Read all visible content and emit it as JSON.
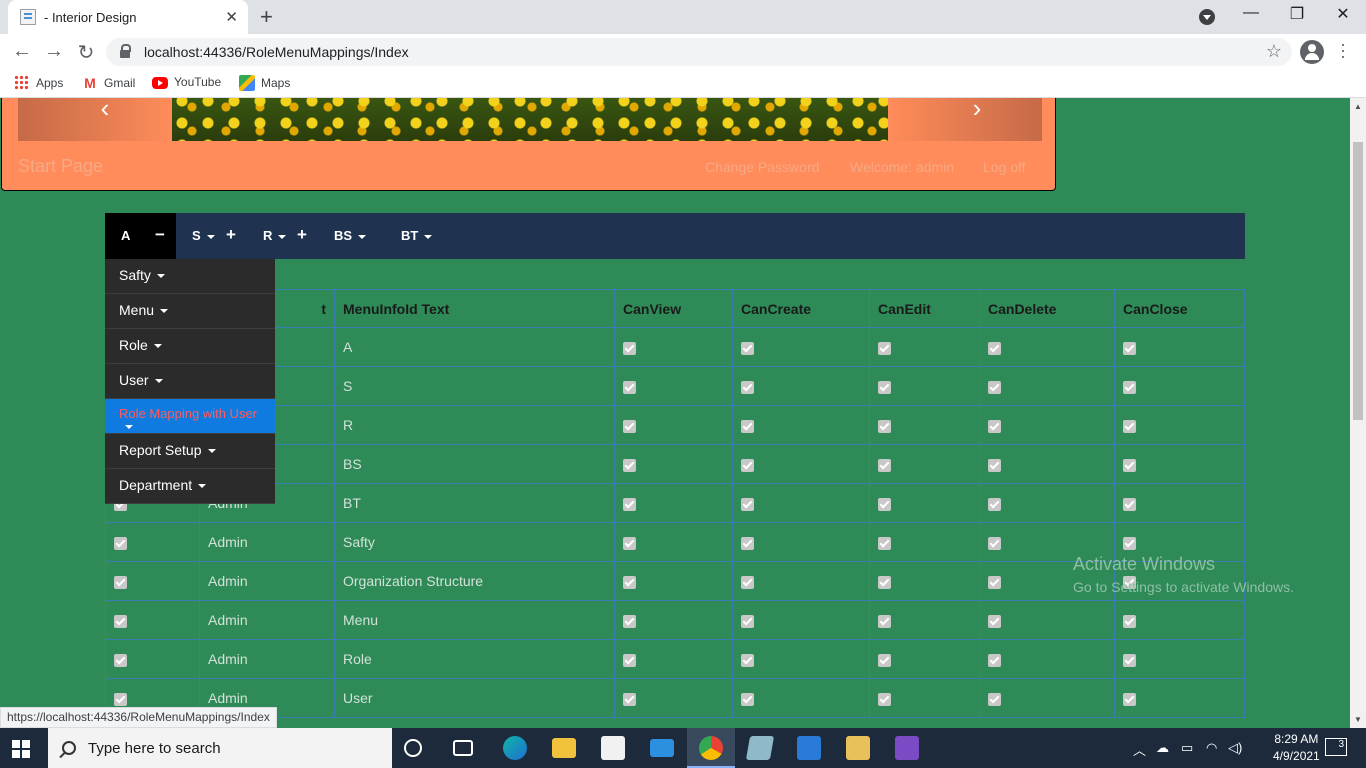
{
  "browser": {
    "tab_title": "- Interior Design",
    "url": "localhost:44336/RoleMenuMappings/Index",
    "bookmarks": [
      "Apps",
      "Gmail",
      "YouTube",
      "Maps"
    ],
    "status_url": "https://localhost:44336/RoleMenuMappings/Index"
  },
  "header": {
    "start_page": "Start Page",
    "change_password": "Change Password",
    "welcome": "Welcome: admin",
    "logoff": "Log off"
  },
  "nav": {
    "items": [
      "A",
      "S",
      "R",
      "BS",
      "BT"
    ],
    "active": "A"
  },
  "dropdown": {
    "items": [
      "Safty",
      "Menu",
      "Role",
      "User",
      "Role Mapping with User",
      "Report Setup",
      "Department"
    ],
    "active_item": "Role Mapping with User"
  },
  "table": {
    "columns": [
      "",
      "",
      "MenuInfoId Text",
      "CanView",
      "CanCreate",
      "CanEdit",
      "CanDelete",
      "CanClose"
    ],
    "header_partial": "t",
    "rows": [
      {
        "role": "",
        "menu": "A"
      },
      {
        "role": "",
        "menu": "S"
      },
      {
        "role": "",
        "menu": "R"
      },
      {
        "role": "",
        "menu": "BS"
      },
      {
        "role": "Admin",
        "menu": "BT"
      },
      {
        "role": "Admin",
        "menu": "Safty"
      },
      {
        "role": "Admin",
        "menu": "Organization Structure"
      },
      {
        "role": "Admin",
        "menu": "Menu"
      },
      {
        "role": "Admin",
        "menu": "Role"
      },
      {
        "role": "Admin",
        "menu": "User"
      }
    ]
  },
  "watermark": {
    "line1": "Activate Windows",
    "line2": "Go to Settings to activate Windows."
  },
  "taskbar": {
    "search_placeholder": "Type here to search",
    "time": "8:29 AM",
    "date": "4/9/2021",
    "notifications": "3"
  }
}
